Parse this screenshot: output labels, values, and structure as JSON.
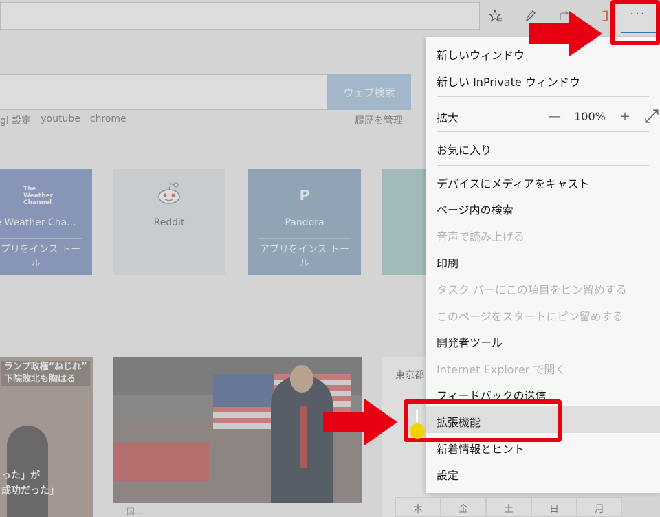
{
  "toolbar": {
    "more_button_label": "···",
    "icons": [
      "favorites-icon",
      "notes-icon",
      "share-icon",
      "office-icon",
      "more-icon"
    ]
  },
  "search": {
    "button_label": "ウェブ検索",
    "quick_links": [
      "gl 設定",
      "youtube",
      "chrome"
    ],
    "manage_history": "履歴を管理"
  },
  "tiles": [
    {
      "logo": "The Weather Channel",
      "name": "e Weather Cha...",
      "action": "アプリをインス トール",
      "logo_lines": [
        "The",
        "Weather",
        "Channel"
      ]
    },
    {
      "name": "Reddit"
    },
    {
      "letter": "P",
      "name": "Pandora",
      "action": "アプリをインス トール"
    }
  ],
  "news": {
    "left_headline_line1": "ランプ政権“ねじれ”",
    "left_headline_line2": "下院敗北も胸はる",
    "left_caption_line1": "った」が",
    "left_caption_line2": "成功だった」",
    "main_caption": "国..."
  },
  "weather": {
    "city": "東京都",
    "days": [
      "木",
      "金",
      "土",
      "日",
      "月"
    ]
  },
  "menu": {
    "items": [
      {
        "label": "新しいウィンドウ",
        "enabled": true
      },
      {
        "label": "新しい InPrivate ウィンドウ",
        "enabled": true
      },
      {
        "label": "拡大",
        "enabled": true
      },
      {
        "label": "お気に入り",
        "enabled": true
      },
      {
        "label": "デバイスにメディアをキャスト",
        "enabled": true
      },
      {
        "label": "ページ内の検索",
        "enabled": true
      },
      {
        "label": "音声で読み上げる",
        "enabled": false
      },
      {
        "label": "印刷",
        "enabled": true
      },
      {
        "label": "タスク バーにこの項目をピン留めする",
        "enabled": false
      },
      {
        "label": "このページをスタートにピン留めする",
        "enabled": false
      },
      {
        "label": "開発者ツール",
        "enabled": true
      },
      {
        "label": "Internet Explorer で開く",
        "enabled": false
      },
      {
        "label": "フィードバックの送信",
        "enabled": true
      },
      {
        "label": "拡張機能",
        "enabled": true,
        "highlighted": true
      },
      {
        "label": "新着情報とヒント",
        "enabled": true
      },
      {
        "label": "設定",
        "enabled": true
      }
    ],
    "zoom": {
      "minus": "—",
      "value": "100%",
      "plus": "+"
    }
  },
  "colors": {
    "accent": "#0063b1",
    "annotation_red": "#e60012",
    "menu_bg": "#f7f7f7",
    "disabled_text": "#b5b5b5"
  }
}
